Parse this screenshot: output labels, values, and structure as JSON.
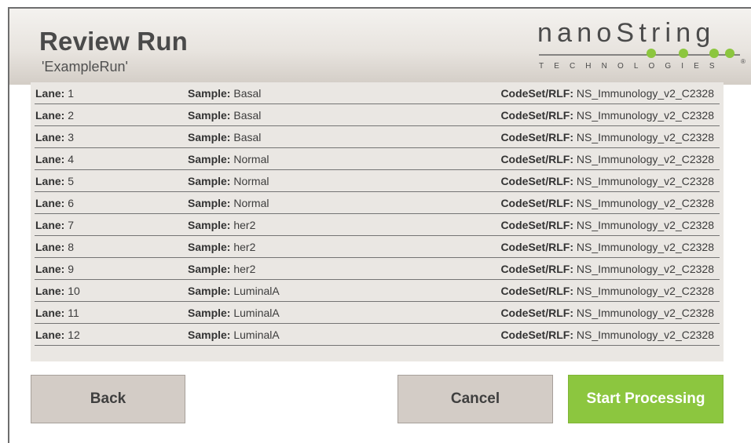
{
  "header": {
    "title": "Review Run",
    "run_name": "'ExampleRun'",
    "logo": {
      "word": "nanoString",
      "sub": "TECHNOLOGIES",
      "registered": "®",
      "accent": "#8cc63f"
    }
  },
  "labels": {
    "lane": "Lane:",
    "sample": "Sample:",
    "codeset": "CodeSet/RLF:"
  },
  "rows": [
    {
      "lane": "1",
      "sample": "Basal",
      "codeset": "NS_Immunology_v2_C2328"
    },
    {
      "lane": "2",
      "sample": "Basal",
      "codeset": "NS_Immunology_v2_C2328"
    },
    {
      "lane": "3",
      "sample": "Basal",
      "codeset": "NS_Immunology_v2_C2328"
    },
    {
      "lane": "4",
      "sample": "Normal",
      "codeset": "NS_Immunology_v2_C2328"
    },
    {
      "lane": "5",
      "sample": "Normal",
      "codeset": "NS_Immunology_v2_C2328"
    },
    {
      "lane": "6",
      "sample": "Normal",
      "codeset": "NS_Immunology_v2_C2328"
    },
    {
      "lane": "7",
      "sample": "her2",
      "codeset": "NS_Immunology_v2_C2328"
    },
    {
      "lane": "8",
      "sample": "her2",
      "codeset": "NS_Immunology_v2_C2328"
    },
    {
      "lane": "9",
      "sample": "her2",
      "codeset": "NS_Immunology_v2_C2328"
    },
    {
      "lane": "10",
      "sample": "LuminalA",
      "codeset": "NS_Immunology_v2_C2328"
    },
    {
      "lane": "11",
      "sample": "LuminalA",
      "codeset": "NS_Immunology_v2_C2328"
    },
    {
      "lane": "12",
      "sample": "LuminalA",
      "codeset": "NS_Immunology_v2_C2328"
    }
  ],
  "buttons": {
    "back": "Back",
    "cancel": "Cancel",
    "start": "Start Processing"
  },
  "colors": {
    "header_bg": "#e8e4df",
    "panel_bg": "#eae7e3",
    "button_gray": "#d3ccc6",
    "button_primary": "#8cc63f"
  }
}
